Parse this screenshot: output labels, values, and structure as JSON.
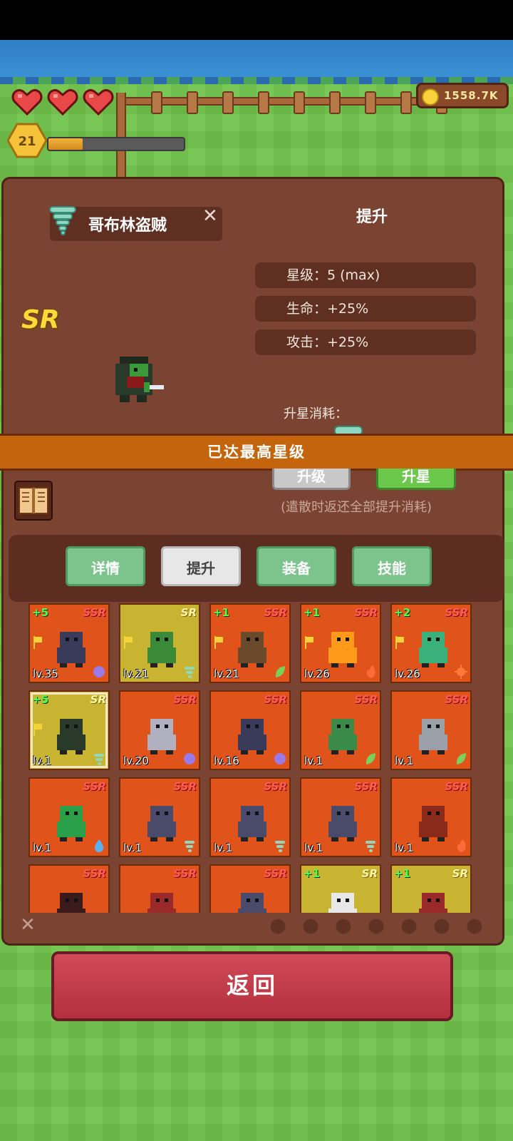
{
  "hud": {
    "hearts": 3,
    "level": "21",
    "xp_fraction": 0.25,
    "gold": "1558.7K"
  },
  "unit": {
    "name": "哥布林盗贼",
    "rarity": "SR",
    "element_icon": "tornado-icon"
  },
  "upgrade": {
    "title": "提升",
    "stats": [
      "星级：5 (max)",
      "生命：+25%",
      "攻击：+25%"
    ],
    "cost_label": "升星消耗：",
    "banner": "已达最高星级",
    "level_up_button": "升级",
    "star_up_button": "升星",
    "note": "(遣散时返还全部提升消耗)"
  },
  "tabs": [
    {
      "label": "详情",
      "active": false
    },
    {
      "label": "提升",
      "active": true
    },
    {
      "label": "装备",
      "active": false
    },
    {
      "label": "技能",
      "active": false
    }
  ],
  "roster": [
    {
      "rarity": "SSR",
      "plus": "+5",
      "level": "lv.35",
      "flag": true,
      "element": "moon",
      "sprite": "knight",
      "sprite_color": "#3a3a5a"
    },
    {
      "rarity": "SR",
      "plus": "",
      "level": "lv.21",
      "flag": true,
      "element": "wind",
      "sprite": "goblin",
      "sprite_color": "#3a8a3a"
    },
    {
      "rarity": "SSR",
      "plus": "+1",
      "level": "lv.21",
      "flag": true,
      "element": "leaf",
      "sprite": "treant",
      "sprite_color": "#6a4a2a"
    },
    {
      "rarity": "SSR",
      "plus": "+1",
      "level": "lv.26",
      "flag": true,
      "element": "fire",
      "sprite": "fire-elemental",
      "sprite_color": "#ff9a1a"
    },
    {
      "rarity": "SSR",
      "plus": "+2",
      "level": "lv.26",
      "flag": true,
      "element": "sun",
      "sprite": "ghost",
      "sprite_color": "#3ab07a"
    },
    {
      "rarity": "SR",
      "plus": "+5",
      "level": "lv.1",
      "flag": true,
      "element": "wind",
      "sprite": "goblin-thief",
      "sprite_color": "#2a3a2a",
      "selected": true
    },
    {
      "rarity": "SSR",
      "plus": "",
      "level": "lv.20",
      "flag": false,
      "element": "moon",
      "sprite": "ghost-gunner",
      "sprite_color": "#b0b0c0"
    },
    {
      "rarity": "SSR",
      "plus": "",
      "level": "lv.16",
      "flag": false,
      "element": "moon",
      "sprite": "reaper",
      "sprite_color": "#3a3a5a"
    },
    {
      "rarity": "SSR",
      "plus": "",
      "level": "lv.1",
      "flag": false,
      "element": "leaf",
      "sprite": "necromancer",
      "sprite_color": "#3a8a4a"
    },
    {
      "rarity": "SSR",
      "plus": "",
      "level": "lv.1",
      "flag": false,
      "element": "leaf",
      "sprite": "werewolf",
      "sprite_color": "#9aa0a8"
    },
    {
      "rarity": "SSR",
      "plus": "",
      "level": "lv.1",
      "flag": false,
      "element": "water",
      "sprite": "slime",
      "sprite_color": "#2aa04a"
    },
    {
      "rarity": "SSR",
      "plus": "",
      "level": "lv.1",
      "flag": false,
      "element": "wind",
      "sprite": "harpy",
      "sprite_color": "#4a4a6a"
    },
    {
      "rarity": "SSR",
      "plus": "",
      "level": "lv.1",
      "flag": false,
      "element": "wind",
      "sprite": "harpy",
      "sprite_color": "#4a4a6a"
    },
    {
      "rarity": "SSR",
      "plus": "",
      "level": "lv.1",
      "flag": false,
      "element": "wind",
      "sprite": "harpy",
      "sprite_color": "#4a4a6a"
    },
    {
      "rarity": "SSR",
      "plus": "",
      "level": "lv.1",
      "flag": false,
      "element": "fire",
      "sprite": "minotaur",
      "sprite_color": "#8a2a1a"
    },
    {
      "rarity": "SSR",
      "plus": "",
      "level": "",
      "flag": false,
      "element": "",
      "sprite": "demon",
      "sprite_color": "#3a1a1a"
    },
    {
      "rarity": "SSR",
      "plus": "",
      "level": "",
      "flag": false,
      "element": "",
      "sprite": "demon",
      "sprite_color": "#9a2a2a"
    },
    {
      "rarity": "SSR",
      "plus": "",
      "level": "",
      "flag": false,
      "element": "",
      "sprite": "imp",
      "sprite_color": "#4a4a6a"
    },
    {
      "rarity": "SR",
      "plus": "+1",
      "level": "",
      "flag": false,
      "element": "",
      "sprite": "eyeball",
      "sprite_color": "#e8e8e8"
    },
    {
      "rarity": "SR",
      "plus": "+1",
      "level": "",
      "flag": false,
      "element": "",
      "sprite": "demon",
      "sprite_color": "#9a2a2a"
    }
  ],
  "filters": [
    "leaf",
    "earth",
    "water",
    "wind",
    "fire",
    "sun",
    "moon"
  ],
  "back_button": "返回",
  "colors": {
    "ssr_card": "#e0531a",
    "sr_card": "#c8b431",
    "panel": "#7b4332",
    "banner": "#c4640c",
    "back": "#c23a48"
  }
}
